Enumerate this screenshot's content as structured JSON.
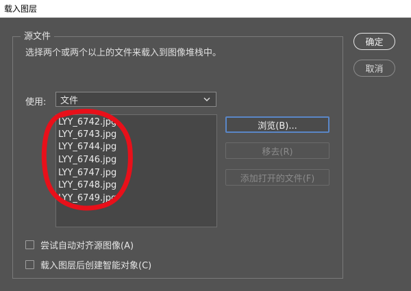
{
  "window": {
    "title": "载入图层"
  },
  "source_group": {
    "title": "源文件",
    "description": "选择两个或两个以上的文件来载入到图像堆栈中。",
    "use_label": "使用:",
    "use_select": {
      "value": "文件"
    },
    "files": [
      "LYY_6742.jpg",
      "LYY_6743.jpg",
      "LYY_6744.jpg",
      "LYY_6746.jpg",
      "LYY_6747.jpg",
      "LYY_6748.jpg",
      "LYY_6749.jpg"
    ],
    "browse_label": "浏览(B)...",
    "remove_label": "移去(R)",
    "add_open_label": "添加打开的文件(F)"
  },
  "actions": {
    "ok_label": "确定",
    "cancel_label": "取消"
  },
  "options": {
    "auto_align_label": "尝试自动对齐源图像(A)",
    "auto_align_checked": false,
    "smart_object_label": "载入图层后创建智能对象(C)",
    "smart_object_checked": false
  },
  "colors": {
    "background": "#535353",
    "annotation": "#e8101a",
    "focus": "#5a87c8"
  }
}
